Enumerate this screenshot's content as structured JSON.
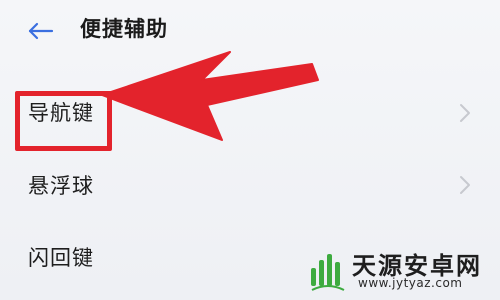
{
  "header": {
    "title": "便捷辅助",
    "back_icon": "back-arrow-icon"
  },
  "list": {
    "items": [
      {
        "label": "导航键",
        "chevron_icon": "chevron-right-icon",
        "highlighted": true
      },
      {
        "label": "悬浮球",
        "chevron_icon": "chevron-right-icon",
        "highlighted": false
      },
      {
        "label": "闪回键",
        "chevron_icon": "chevron-right-icon",
        "highlighted": false
      }
    ]
  },
  "annotation": {
    "color": "#e3232c"
  },
  "watermark": {
    "name": "天源安卓网",
    "url": "www.jytyaz.com",
    "logo_color": "#3dab3f"
  },
  "colors": {
    "back_arrow": "#3a6fe0",
    "chevron": "#c7c9cf"
  }
}
